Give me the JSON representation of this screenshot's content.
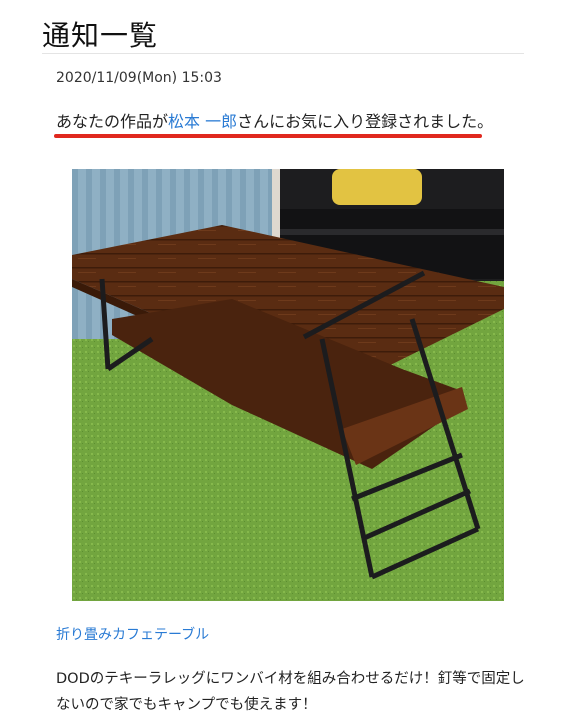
{
  "page": {
    "title": "通知一覧"
  },
  "notification": {
    "timestamp": "2020/11/09(Mon) 15:03",
    "message_prefix": "あなたの作品が",
    "user_name": "松本 一郎",
    "message_suffix": "さんにお気に入り登録されました。",
    "work": {
      "image_icon": "table-photo",
      "title": "折り畳みカフェテーブル",
      "description": "DODのテキーラレッグにワンバイ材を組み合わせるだけ！釘等で固定しないので家でもキャンプでも使えます！"
    }
  },
  "colors": {
    "link": "#2a7bd4",
    "accent_underline": "#e0281e",
    "text": "#222222"
  }
}
